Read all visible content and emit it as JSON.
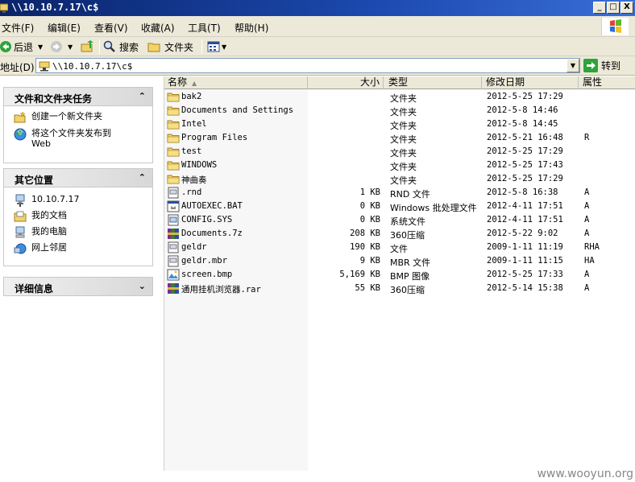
{
  "window": {
    "title": "\\\\10.10.7.17\\c$",
    "btn_min": "_",
    "btn_max": "□",
    "btn_close": "X"
  },
  "menu": [
    "文件(F)",
    "编辑(E)",
    "查看(V)",
    "收藏(A)",
    "工具(T)",
    "帮助(H)"
  ],
  "toolbar": {
    "back": "后退",
    "search": "搜索",
    "folders": "文件夹"
  },
  "address": {
    "label": "地址(D)",
    "value": "\\\\10.10.7.17\\c$",
    "go": "转到"
  },
  "tasks_panel": {
    "title": "文件和文件夹任务",
    "items": [
      "创建一个新文件夹",
      "将这个文件夹发布到",
      "Web"
    ]
  },
  "places_panel": {
    "title": "其它位置",
    "items": [
      "10.10.7.17",
      "我的文档",
      "我的电脑",
      "网上邻居"
    ]
  },
  "details_panel": {
    "title": "详细信息"
  },
  "columns": {
    "name": "名称",
    "size": "大小",
    "type": "类型",
    "modified": "修改日期",
    "attr": "属性"
  },
  "files": [
    {
      "icon": "folder",
      "name": "bak2",
      "size": "",
      "type": "文件夹",
      "date": "2012-5-25 17:29",
      "attr": ""
    },
    {
      "icon": "folder",
      "name": "Documents and Settings",
      "size": "",
      "type": "文件夹",
      "date": "2012-5-8 14:46",
      "attr": ""
    },
    {
      "icon": "folder",
      "name": "Intel",
      "size": "",
      "type": "文件夹",
      "date": "2012-5-8 14:45",
      "attr": ""
    },
    {
      "icon": "folder",
      "name": "Program Files",
      "size": "",
      "type": "文件夹",
      "date": "2012-5-21 16:48",
      "attr": "R"
    },
    {
      "icon": "folder",
      "name": "test",
      "size": "",
      "type": "文件夹",
      "date": "2012-5-25 17:29",
      "attr": ""
    },
    {
      "icon": "folder",
      "name": "WINDOWS",
      "size": "",
      "type": "文件夹",
      "date": "2012-5-25 17:43",
      "attr": ""
    },
    {
      "icon": "folder",
      "name": "神曲奏",
      "size": "",
      "type": "文件夹",
      "date": "2012-5-25 17:29",
      "attr": ""
    },
    {
      "icon": "file",
      "name": ".rnd",
      "size": "1 KB",
      "type": "RND 文件",
      "date": "2012-5-8 16:38",
      "attr": "A"
    },
    {
      "icon": "bat",
      "name": "AUTOEXEC.BAT",
      "size": "0 KB",
      "type": "Windows 批处理文件",
      "date": "2012-4-11 17:51",
      "attr": "A"
    },
    {
      "icon": "sys",
      "name": "CONFIG.SYS",
      "size": "0 KB",
      "type": "系统文件",
      "date": "2012-4-11 17:51",
      "attr": "A"
    },
    {
      "icon": "archive",
      "name": "Documents.7z",
      "size": "208 KB",
      "type": "360压缩",
      "date": "2012-5-22 9:02",
      "attr": "A"
    },
    {
      "icon": "file",
      "name": "geldr",
      "size": "190 KB",
      "type": "文件",
      "date": "2009-1-11 11:19",
      "attr": "RHA"
    },
    {
      "icon": "file",
      "name": "geldr.mbr",
      "size": "9 KB",
      "type": "MBR 文件",
      "date": "2009-1-11 11:15",
      "attr": "HA"
    },
    {
      "icon": "image",
      "name": "screen.bmp",
      "size": "5,169 KB",
      "type": "BMP 图像",
      "date": "2012-5-25 17:33",
      "attr": "A"
    },
    {
      "icon": "archive",
      "name": "通用挂机浏览器.rar",
      "size": "55 KB",
      "type": "360压缩",
      "date": "2012-5-14 15:38",
      "attr": "A"
    }
  ],
  "watermark": "www.wooyun.org"
}
